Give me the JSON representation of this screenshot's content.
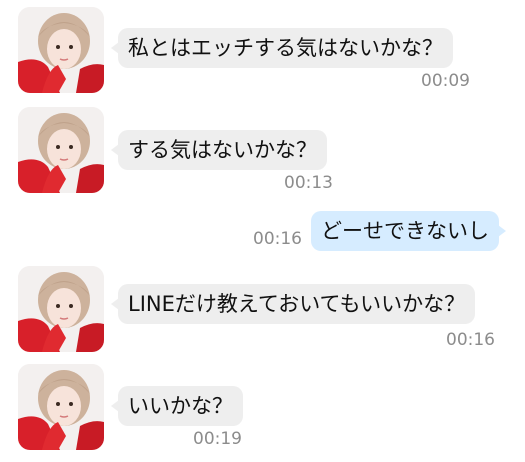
{
  "conversation": {
    "messages": [
      {
        "direction": "incoming",
        "text": "私とはエッチする気はないかな？",
        "time": "00:09"
      },
      {
        "direction": "incoming",
        "text": "する気はないかな？",
        "time": "00:13"
      },
      {
        "direction": "outgoing",
        "text": "どーせできないし",
        "time": "00:16"
      },
      {
        "direction": "incoming",
        "text": "LINEだけ教えておいてもいいかな？",
        "time": "00:16"
      },
      {
        "direction": "incoming",
        "text": "いいかな？",
        "time": "00:19"
      }
    ]
  },
  "colors": {
    "incoming_bubble": "#eeeeee",
    "outgoing_bubble": "#d6ecff",
    "timestamp": "#8c8c8c",
    "avatar_clothing": "#d8202a"
  },
  "icons": {
    "avatar": "girl-avatar-photo"
  }
}
